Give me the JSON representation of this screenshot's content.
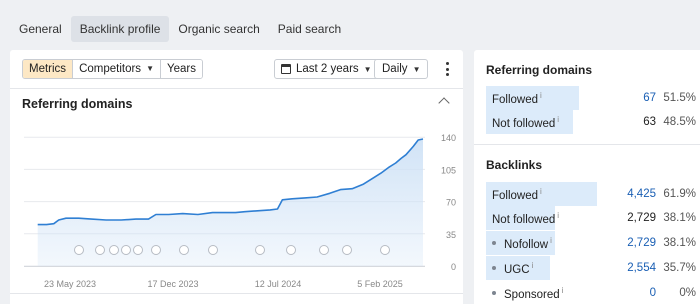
{
  "tabs": [
    {
      "label": "General",
      "active": false
    },
    {
      "label": "Backlink profile",
      "active": true
    },
    {
      "label": "Organic search",
      "active": false
    },
    {
      "label": "Paid search",
      "active": false
    }
  ],
  "toolbar": {
    "metrics_label": "Metrics",
    "competitors_label": "Competitors",
    "years_label": "Years",
    "date_range_label": "Last 2 years",
    "granularity_label": "Daily"
  },
  "chart_panel": {
    "title": "Referring domains"
  },
  "colors": {
    "accent_line": "#2f7fd3",
    "area_fill": "#cfe2f6",
    "metrics_active": "#fde8c5",
    "bar_fill": "#dcebfa",
    "link_value": "#1a5fb4"
  },
  "chart_data": {
    "type": "area",
    "title": "Referring domains",
    "xlabel": "",
    "ylabel": "",
    "x_ticks": [
      "23 May 2023",
      "17 Dec 2023",
      "12 Jul 2024",
      "5 Feb 2025"
    ],
    "y_ticks": [
      "0",
      "35",
      "70",
      "105",
      "140"
    ],
    "ylim": [
      0,
      150
    ],
    "grid": true,
    "event_markers": [
      "a",
      "a",
      "a",
      "G",
      "G",
      "G",
      "G",
      "a",
      "a",
      "a",
      "a",
      "a",
      "a",
      "a",
      "G",
      "a",
      "G",
      "a",
      "G",
      "G",
      "a",
      "a",
      "a",
      "a",
      "a",
      "G",
      "a",
      "a"
    ],
    "series": [
      {
        "points": [
          [
            "2023-05-23",
            45
          ],
          [
            "2023-06-10",
            45
          ],
          [
            "2023-06-25",
            46
          ],
          [
            "2023-07-05",
            50
          ],
          [
            "2023-07-20",
            52
          ],
          [
            "2023-08-15",
            52
          ],
          [
            "2023-09-10",
            51
          ],
          [
            "2023-10-10",
            50
          ],
          [
            "2023-11-10",
            50
          ],
          [
            "2023-12-10",
            51
          ],
          [
            "2024-01-05",
            51
          ],
          [
            "2024-01-20",
            56
          ],
          [
            "2024-02-15",
            56
          ],
          [
            "2024-03-15",
            57
          ],
          [
            "2024-04-15",
            56
          ],
          [
            "2024-05-15",
            58
          ],
          [
            "2024-06-10",
            58
          ],
          [
            "2024-07-01",
            58
          ],
          [
            "2024-07-20",
            59
          ],
          [
            "2024-08-15",
            60
          ],
          [
            "2024-09-10",
            61
          ],
          [
            "2024-09-25",
            62
          ],
          [
            "2024-10-05",
            72
          ],
          [
            "2024-10-25",
            73
          ],
          [
            "2024-11-20",
            74
          ],
          [
            "2024-12-15",
            75
          ],
          [
            "2025-01-10",
            79
          ],
          [
            "2025-02-01",
            83
          ],
          [
            "2025-02-25",
            84
          ],
          [
            "2025-03-20",
            89
          ],
          [
            "2025-04-10",
            96
          ],
          [
            "2025-04-25",
            101
          ],
          [
            "2025-05-10",
            107
          ],
          [
            "2025-05-25",
            112
          ],
          [
            "2025-06-05",
            117
          ],
          [
            "2025-06-15",
            121
          ],
          [
            "2025-06-30",
            130
          ],
          [
            "2025-07-10",
            137
          ],
          [
            "2025-07-20",
            138
          ]
        ]
      }
    ]
  },
  "side": {
    "referring": {
      "title": "Referring domains",
      "rows": [
        {
          "label": "Followed",
          "value": "67",
          "pct": "51.5%",
          "bar": 0.515,
          "link": true
        },
        {
          "label": "Not followed",
          "value": "63",
          "pct": "48.5%",
          "bar": 0.485,
          "link": false
        }
      ]
    },
    "backlinks": {
      "title": "Backlinks",
      "rows": [
        {
          "label": "Followed",
          "value": "4,425",
          "pct": "61.9%",
          "bar": 0.619,
          "link": true,
          "sub": false
        },
        {
          "label": "Not followed",
          "value": "2,729",
          "pct": "38.1%",
          "bar": 0.381,
          "link": false,
          "sub": false
        },
        {
          "label": "Nofollow",
          "value": "2,729",
          "pct": "38.1%",
          "bar": 0.381,
          "link": true,
          "sub": true
        },
        {
          "label": "UGC",
          "value": "2,554",
          "pct": "35.7%",
          "bar": 0.357,
          "link": true,
          "sub": true
        },
        {
          "label": "Sponsored",
          "value": "0",
          "pct": "0%",
          "bar": 0,
          "link": true,
          "sub": true
        }
      ]
    },
    "info_mark": "i"
  }
}
